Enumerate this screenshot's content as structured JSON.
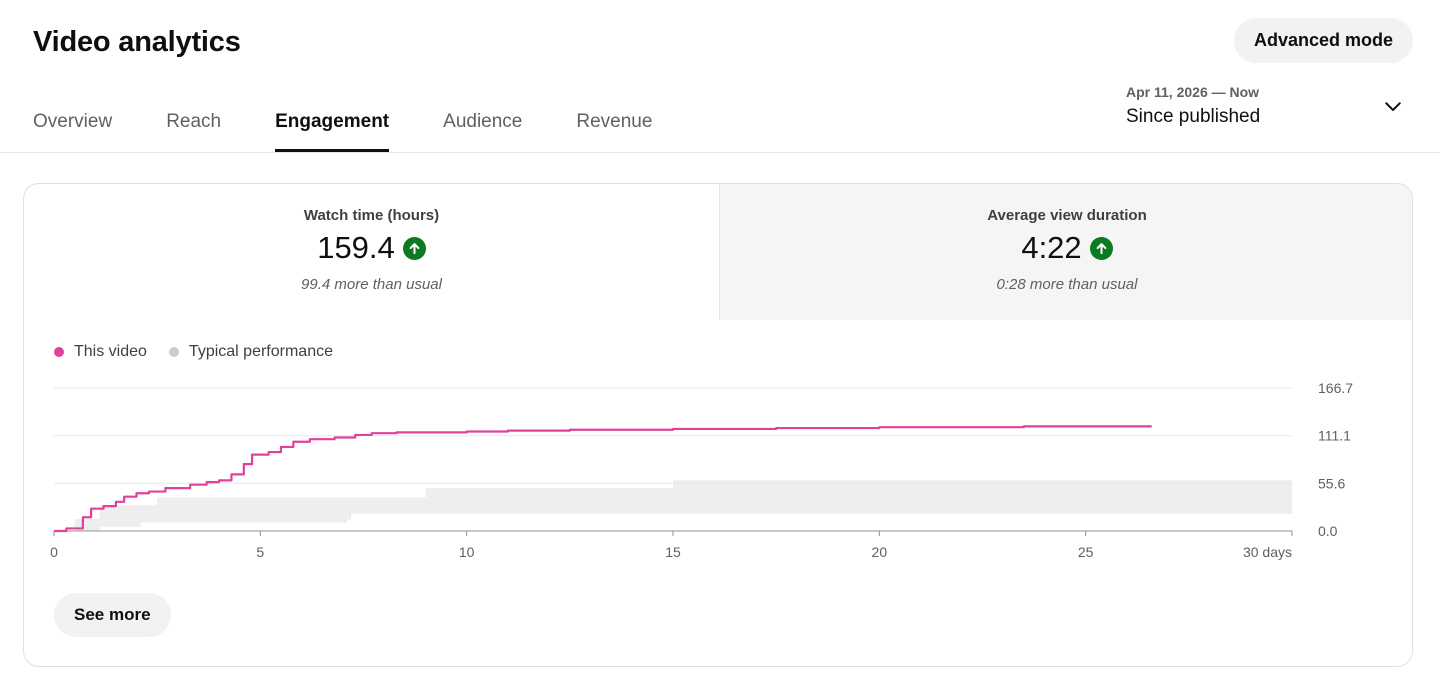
{
  "header": {
    "title": "Video analytics",
    "advanced_label": "Advanced mode"
  },
  "tabs": [
    {
      "label": "Overview",
      "active": false
    },
    {
      "label": "Reach",
      "active": false
    },
    {
      "label": "Engagement",
      "active": true
    },
    {
      "label": "Audience",
      "active": false
    },
    {
      "label": "Revenue",
      "active": false
    }
  ],
  "range": {
    "dates": "Apr 11, 2026 — Now",
    "label": "Since published",
    "icon": "chevron-down-icon"
  },
  "metrics": [
    {
      "label": "Watch time (hours)",
      "value": "159.4",
      "note": "99.4 more than usual",
      "trend_icon": "arrow-up-icon"
    },
    {
      "label": "Average view duration",
      "value": "4:22",
      "note": "0:28 more than usual",
      "trend_icon": "arrow-up-icon"
    }
  ],
  "legend": [
    {
      "label": "This video",
      "color": "#e0419b"
    },
    {
      "label": "Typical performance",
      "color": "#cccccc"
    }
  ],
  "see_more_label": "See more",
  "chart_data": {
    "type": "line",
    "x_ticks": [
      "0",
      "5",
      "10",
      "15",
      "20",
      "25",
      "30 days"
    ],
    "y_ticks": [
      "0.0",
      "55.6",
      "111.1",
      "166.7"
    ],
    "ylim": [
      0,
      166.7
    ],
    "xlim": [
      0,
      30
    ],
    "grid": true,
    "series": [
      {
        "name": "This video",
        "color": "#e0419b",
        "points": [
          [
            0,
            0
          ],
          [
            0.3,
            3
          ],
          [
            0.7,
            16
          ],
          [
            0.9,
            26
          ],
          [
            1.2,
            29
          ],
          [
            1.5,
            34
          ],
          [
            1.7,
            40
          ],
          [
            2.0,
            44
          ],
          [
            2.3,
            46
          ],
          [
            2.7,
            50
          ],
          [
            3.3,
            54
          ],
          [
            3.7,
            57
          ],
          [
            4.0,
            59
          ],
          [
            4.3,
            66
          ],
          [
            4.6,
            78
          ],
          [
            4.8,
            89
          ],
          [
            5.2,
            92
          ],
          [
            5.5,
            98
          ],
          [
            5.8,
            104
          ],
          [
            6.2,
            107
          ],
          [
            6.8,
            109
          ],
          [
            7.3,
            112
          ],
          [
            7.7,
            114
          ],
          [
            8.3,
            115
          ],
          [
            10.0,
            116
          ],
          [
            11.0,
            117
          ],
          [
            12.5,
            118
          ],
          [
            15.0,
            119
          ],
          [
            17.5,
            120
          ],
          [
            20.0,
            121
          ],
          [
            23.5,
            122
          ],
          [
            26.6,
            122
          ]
        ]
      },
      {
        "name": "Typical performance",
        "color": "#eeeeee",
        "upper": [
          [
            0.5,
            14
          ],
          [
            1.1,
            30
          ],
          [
            2.5,
            39
          ],
          [
            9.0,
            50
          ],
          [
            15.0,
            59
          ],
          [
            30,
            59
          ]
        ],
        "lower": [
          [
            0.5,
            0
          ],
          [
            1.1,
            5
          ],
          [
            2.1,
            10
          ],
          [
            7.1,
            13
          ],
          [
            7.2,
            20
          ],
          [
            30,
            20
          ]
        ]
      }
    ]
  }
}
